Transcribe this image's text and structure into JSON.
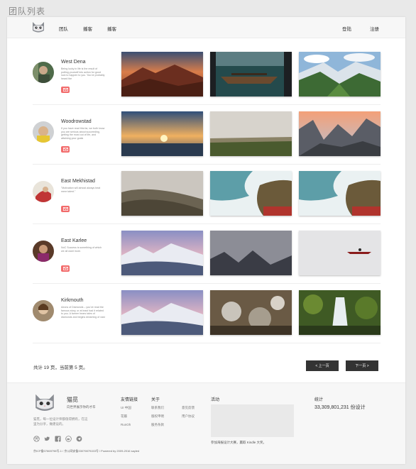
{
  "page_heading": "团队列表",
  "nav": {
    "left": [
      "团队",
      "播客",
      "播客"
    ],
    "right": [
      "登陆",
      "注册"
    ]
  },
  "members": [
    {
      "name": "West Dena",
      "bio": "Being lucky in life is the result of putting yourself into action for good luck to happen to you. You've probably heard the"
    },
    {
      "name": "Woodrowstad",
      "bio": "If you have read this far, we both know you are serious about succeeding, getting the most out of life, and attaining your goals"
    },
    {
      "name": "East Mekhistad",
      "bio": "\"Motivation will almost always beat mere talent.\""
    },
    {
      "name": "East Karlee",
      "bio": "NoC Success is something of which we all want more."
    },
    {
      "name": "Kirkmouth",
      "bio": "Aeons of Diamonds – you've read the famous story, or at least had it related to you. A farmer hears tales of diamonds and begins dreaming of vast riches."
    }
  ],
  "pagination": {
    "info": "共计 19 页，当前第 5 页。",
    "prev": "< 上一页",
    "next": "下一页 >"
  },
  "footer": {
    "title": "猫觅",
    "slogan": "向世界展示你的才华",
    "description": "猫觅，每一位设计师都值得拥有，在这里为分享，做建设的。",
    "copyright": "京ICP备07869798号-1 / 京公网安备33079879153号 / Powered by 2009-2016 sayled",
    "links_heading": "友情链接",
    "links": [
      "UI 中国",
      "花瓣",
      "RunOh"
    ],
    "about_heading": "关于",
    "about_col1": [
      "联系我们",
      "版权申明",
      "服务条款"
    ],
    "about_col2": [
      "意见反馈",
      "用户协议"
    ],
    "activity_heading": "活动",
    "activity_caption": "参加海报设计大赛，赢取 Kindle 大奖。",
    "stats_heading": "统计",
    "stats_value": "33,309,801,231 份设计"
  },
  "colors": {
    "accent": "#f26c6c",
    "dark_button": "#333333"
  }
}
